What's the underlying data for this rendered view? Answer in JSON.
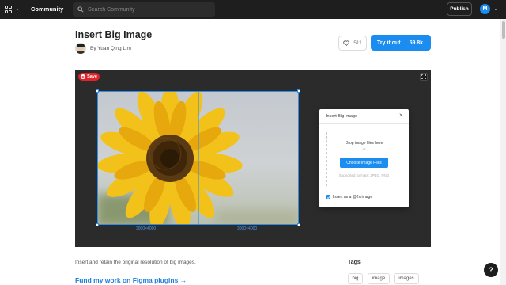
{
  "topbar": {
    "nav_title": "Community",
    "search_placeholder": "Search Community",
    "publish_label": "Publish",
    "user_initial": "M"
  },
  "plugin": {
    "title": "Insert Big Image",
    "author": "By Yuan Qing Lim",
    "likes": "511",
    "try_label": "Try it out",
    "try_count": "59.8k"
  },
  "preview": {
    "save_label": "Save",
    "save_icon": "P",
    "dim_left": "3000×4000",
    "dim_right": "3000×4000",
    "dialog": {
      "title": "Insert Big Image",
      "close": "×",
      "drop_text": "Drop image files here",
      "or_text": "or",
      "choose_label": "Choose Image Files",
      "formats": "Supported formats: JPEG, PNG",
      "checkbox_label": "Insert as a @2x image",
      "checkbox_checked": true
    }
  },
  "description": "Insert and retain the original resolution of big images.",
  "fund_link": "Fund my work on Figma plugins →",
  "tags": {
    "heading": "Tags",
    "items": [
      "big",
      "image",
      "images"
    ]
  },
  "help_label": "?",
  "colors": {
    "topbar_bg": "#1e1e1e",
    "accent": "#1b8cf0",
    "save_red": "#e0222a",
    "preview_bg": "#2b2b2b"
  }
}
